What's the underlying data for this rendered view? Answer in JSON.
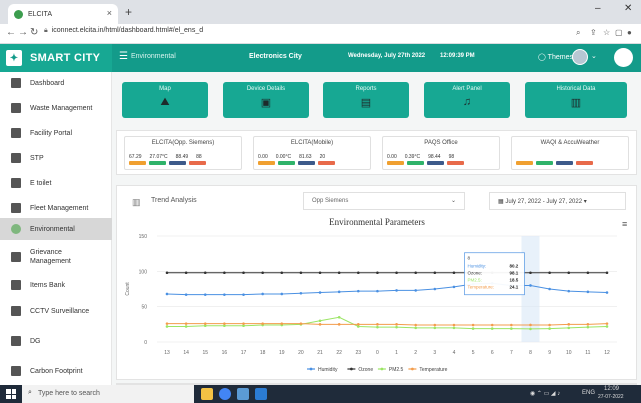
{
  "browser": {
    "tab_title": "ELCITA",
    "url": "iconnect.elcita.in/html/dashboard.html#/el_ens_d",
    "controls": {
      "minimize": "–",
      "close": "✕",
      "new_tab": "+",
      "tab_close": "×"
    }
  },
  "header": {
    "brand": "SMART CITY",
    "section": "Environmental",
    "city": "Electronics City",
    "date": "Wednesday, July 27th 2022",
    "time": "12:09:39 PM",
    "themes": "Themes"
  },
  "sidebar": {
    "items": [
      {
        "label": "Dashboard"
      },
      {
        "label": "Waste Management"
      },
      {
        "label": "Facility Portal"
      },
      {
        "label": "STP"
      },
      {
        "label": "E toilet"
      },
      {
        "label": "Fleet Management"
      },
      {
        "label": "Environmental"
      },
      {
        "label": "Grievance Management"
      },
      {
        "label": "Items Bank"
      },
      {
        "label": "CCTV Surveillance"
      },
      {
        "label": "DG"
      },
      {
        "label": "Carbon Footprint"
      }
    ]
  },
  "quick_tiles": [
    {
      "label": "Map",
      "icon": "map-icon"
    },
    {
      "label": "Device Details",
      "icon": "device-icon"
    },
    {
      "label": "Reports",
      "icon": "report-icon"
    },
    {
      "label": "Alert Panel",
      "icon": "bell-icon"
    },
    {
      "label": "Historical Data",
      "icon": "history-icon"
    }
  ],
  "stat_cards": [
    {
      "title": "ELCITA(Opp. Siemens)",
      "values": [
        "67.29",
        "27.07°C",
        "88.49",
        "88"
      ],
      "tags": [
        "Humidity",
        "Temp",
        "Ozone",
        "AQI"
      ]
    },
    {
      "title": "ELCITA(Mobile)",
      "values": [
        "0.00",
        "0.00°C",
        "81.63",
        "20"
      ],
      "tags": [
        "Humidity",
        "Temp",
        "Ozone",
        "AQI"
      ]
    },
    {
      "title": "PAQS Office",
      "values": [
        "0.00",
        "0.39°C",
        "98.44",
        "98"
      ],
      "tags": [
        "Humidity",
        "Temp",
        "Ozone",
        "AQI"
      ]
    },
    {
      "title": "WAQI & AccuWeather",
      "values": [],
      "tags": [
        "Humidity",
        "Temp",
        "Ozone",
        "AQI"
      ]
    }
  ],
  "trend": {
    "title": "Trend Analysis",
    "station": "Opp Siemens",
    "date_range": "July 27, 2022 - July 27, 2022"
  },
  "tooltip": {
    "title": "8",
    "rows": [
      {
        "label": "Humidity:",
        "value": "80.2"
      },
      {
        "label": "Ozone:",
        "value": "98.1"
      },
      {
        "label": "PM2.5:",
        "value": "18.5"
      },
      {
        "label": "Temperature:",
        "value": "24.1"
      }
    ]
  },
  "chart_data": {
    "type": "line",
    "title": "Environmental Parameters",
    "ylabel": "Count",
    "xlabel": "",
    "ylim": [
      0,
      150
    ],
    "yticks": [
      0,
      50,
      100,
      150
    ],
    "categories": [
      "13",
      "14",
      "15",
      "16",
      "17",
      "18",
      "19",
      "20",
      "21",
      "22",
      "23",
      "0",
      "1",
      "2",
      "3",
      "4",
      "5",
      "6",
      "7",
      "8",
      "9",
      "10",
      "11",
      "12"
    ],
    "grid": true,
    "legend": "bottom",
    "series": [
      {
        "name": "Humidity",
        "color": "#4a90e2",
        "values": [
          68,
          67,
          67,
          67,
          67,
          68,
          68,
          69,
          70,
          71,
          72,
          72,
          73,
          73,
          75,
          78,
          82,
          83,
          80,
          80,
          75,
          72,
          71,
          70
        ]
      },
      {
        "name": "Ozone",
        "color": "#333333",
        "values": [
          98,
          98,
          98,
          98,
          98,
          98,
          98,
          98,
          98,
          98,
          98,
          98,
          98,
          98,
          98,
          98,
          98,
          98,
          98,
          98,
          98,
          98,
          98,
          98
        ]
      },
      {
        "name": "PM2.5",
        "color": "#9be564",
        "values": [
          22,
          22,
          23,
          23,
          23,
          24,
          24,
          25,
          30,
          35,
          22,
          21,
          21,
          20,
          20,
          20,
          19,
          19,
          19,
          18.5,
          19,
          20,
          21,
          22
        ]
      },
      {
        "name": "Temperature",
        "color": "#f39c4b",
        "values": [
          26,
          26,
          26,
          26,
          26,
          26,
          26,
          26,
          25,
          25,
          25,
          25,
          25,
          24,
          24,
          24,
          24,
          24,
          24,
          24.1,
          24,
          25,
          25,
          26
        ]
      }
    ],
    "highlight_category": "8"
  },
  "taskbar": {
    "search_placeholder": "Type here to search",
    "lang": "ENG",
    "time": "12:09",
    "date": "27-07-2022"
  },
  "colors": {
    "brand": "#139b8a",
    "tile": "#17a893"
  }
}
